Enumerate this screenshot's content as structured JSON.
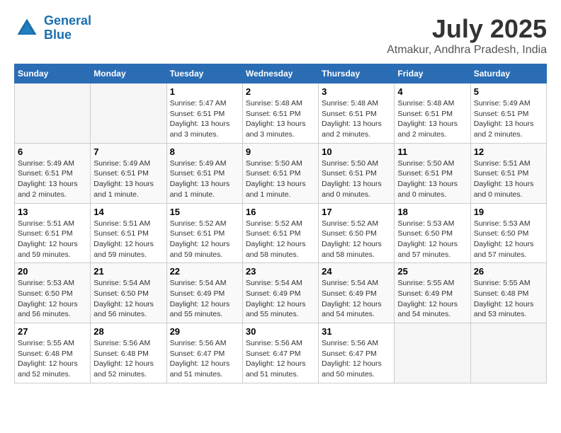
{
  "header": {
    "logo_line1": "General",
    "logo_line2": "Blue",
    "month_year": "July 2025",
    "location": "Atmakur, Andhra Pradesh, India"
  },
  "weekdays": [
    "Sunday",
    "Monday",
    "Tuesday",
    "Wednesday",
    "Thursday",
    "Friday",
    "Saturday"
  ],
  "weeks": [
    [
      {
        "day": "",
        "info": ""
      },
      {
        "day": "",
        "info": ""
      },
      {
        "day": "1",
        "info": "Sunrise: 5:47 AM\nSunset: 6:51 PM\nDaylight: 13 hours and 3 minutes."
      },
      {
        "day": "2",
        "info": "Sunrise: 5:48 AM\nSunset: 6:51 PM\nDaylight: 13 hours and 3 minutes."
      },
      {
        "day": "3",
        "info": "Sunrise: 5:48 AM\nSunset: 6:51 PM\nDaylight: 13 hours and 2 minutes."
      },
      {
        "day": "4",
        "info": "Sunrise: 5:48 AM\nSunset: 6:51 PM\nDaylight: 13 hours and 2 minutes."
      },
      {
        "day": "5",
        "info": "Sunrise: 5:49 AM\nSunset: 6:51 PM\nDaylight: 13 hours and 2 minutes."
      }
    ],
    [
      {
        "day": "6",
        "info": "Sunrise: 5:49 AM\nSunset: 6:51 PM\nDaylight: 13 hours and 2 minutes."
      },
      {
        "day": "7",
        "info": "Sunrise: 5:49 AM\nSunset: 6:51 PM\nDaylight: 13 hours and 1 minute."
      },
      {
        "day": "8",
        "info": "Sunrise: 5:49 AM\nSunset: 6:51 PM\nDaylight: 13 hours and 1 minute."
      },
      {
        "day": "9",
        "info": "Sunrise: 5:50 AM\nSunset: 6:51 PM\nDaylight: 13 hours and 1 minute."
      },
      {
        "day": "10",
        "info": "Sunrise: 5:50 AM\nSunset: 6:51 PM\nDaylight: 13 hours and 0 minutes."
      },
      {
        "day": "11",
        "info": "Sunrise: 5:50 AM\nSunset: 6:51 PM\nDaylight: 13 hours and 0 minutes."
      },
      {
        "day": "12",
        "info": "Sunrise: 5:51 AM\nSunset: 6:51 PM\nDaylight: 13 hours and 0 minutes."
      }
    ],
    [
      {
        "day": "13",
        "info": "Sunrise: 5:51 AM\nSunset: 6:51 PM\nDaylight: 12 hours and 59 minutes."
      },
      {
        "day": "14",
        "info": "Sunrise: 5:51 AM\nSunset: 6:51 PM\nDaylight: 12 hours and 59 minutes."
      },
      {
        "day": "15",
        "info": "Sunrise: 5:52 AM\nSunset: 6:51 PM\nDaylight: 12 hours and 59 minutes."
      },
      {
        "day": "16",
        "info": "Sunrise: 5:52 AM\nSunset: 6:51 PM\nDaylight: 12 hours and 58 minutes."
      },
      {
        "day": "17",
        "info": "Sunrise: 5:52 AM\nSunset: 6:50 PM\nDaylight: 12 hours and 58 minutes."
      },
      {
        "day": "18",
        "info": "Sunrise: 5:53 AM\nSunset: 6:50 PM\nDaylight: 12 hours and 57 minutes."
      },
      {
        "day": "19",
        "info": "Sunrise: 5:53 AM\nSunset: 6:50 PM\nDaylight: 12 hours and 57 minutes."
      }
    ],
    [
      {
        "day": "20",
        "info": "Sunrise: 5:53 AM\nSunset: 6:50 PM\nDaylight: 12 hours and 56 minutes."
      },
      {
        "day": "21",
        "info": "Sunrise: 5:54 AM\nSunset: 6:50 PM\nDaylight: 12 hours and 56 minutes."
      },
      {
        "day": "22",
        "info": "Sunrise: 5:54 AM\nSunset: 6:49 PM\nDaylight: 12 hours and 55 minutes."
      },
      {
        "day": "23",
        "info": "Sunrise: 5:54 AM\nSunset: 6:49 PM\nDaylight: 12 hours and 55 minutes."
      },
      {
        "day": "24",
        "info": "Sunrise: 5:54 AM\nSunset: 6:49 PM\nDaylight: 12 hours and 54 minutes."
      },
      {
        "day": "25",
        "info": "Sunrise: 5:55 AM\nSunset: 6:49 PM\nDaylight: 12 hours and 54 minutes."
      },
      {
        "day": "26",
        "info": "Sunrise: 5:55 AM\nSunset: 6:48 PM\nDaylight: 12 hours and 53 minutes."
      }
    ],
    [
      {
        "day": "27",
        "info": "Sunrise: 5:55 AM\nSunset: 6:48 PM\nDaylight: 12 hours and 52 minutes."
      },
      {
        "day": "28",
        "info": "Sunrise: 5:56 AM\nSunset: 6:48 PM\nDaylight: 12 hours and 52 minutes."
      },
      {
        "day": "29",
        "info": "Sunrise: 5:56 AM\nSunset: 6:47 PM\nDaylight: 12 hours and 51 minutes."
      },
      {
        "day": "30",
        "info": "Sunrise: 5:56 AM\nSunset: 6:47 PM\nDaylight: 12 hours and 51 minutes."
      },
      {
        "day": "31",
        "info": "Sunrise: 5:56 AM\nSunset: 6:47 PM\nDaylight: 12 hours and 50 minutes."
      },
      {
        "day": "",
        "info": ""
      },
      {
        "day": "",
        "info": ""
      }
    ]
  ]
}
